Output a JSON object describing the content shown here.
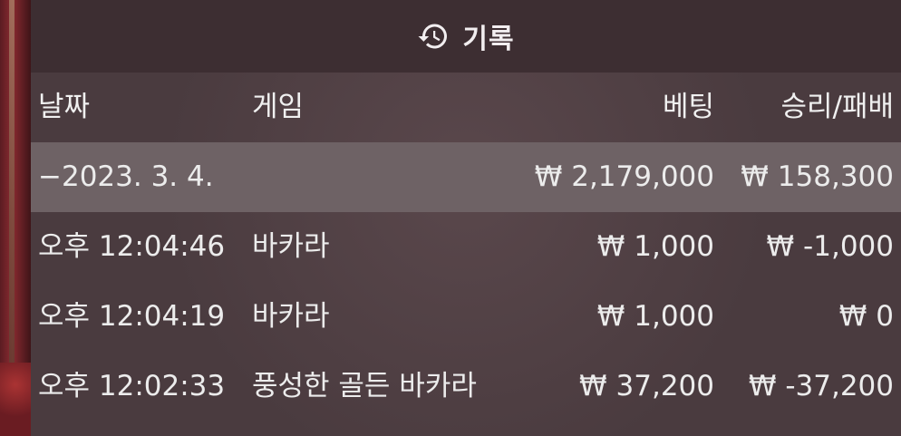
{
  "header": {
    "title": "기록",
    "icon": "history-icon"
  },
  "columns": {
    "date": "날짜",
    "game": "게임",
    "bet": "베팅",
    "result": "승리/패배"
  },
  "summary": {
    "date": "−2023. 3. 4.",
    "bet": "₩ 2,179,000",
    "result": "₩ 158,300"
  },
  "rows": [
    {
      "time": "오후 12:04:46",
      "game": "바카라",
      "bet": "₩ 1,000",
      "result": "₩ -1,000"
    },
    {
      "time": "오후 12:04:19",
      "game": "바카라",
      "bet": "₩ 1,000",
      "result": "₩ 0"
    },
    {
      "time": "오후 12:02:33",
      "game": "풍성한 골든 바카라",
      "bet": "₩ 37,200",
      "result": "₩ -37,200"
    }
  ]
}
